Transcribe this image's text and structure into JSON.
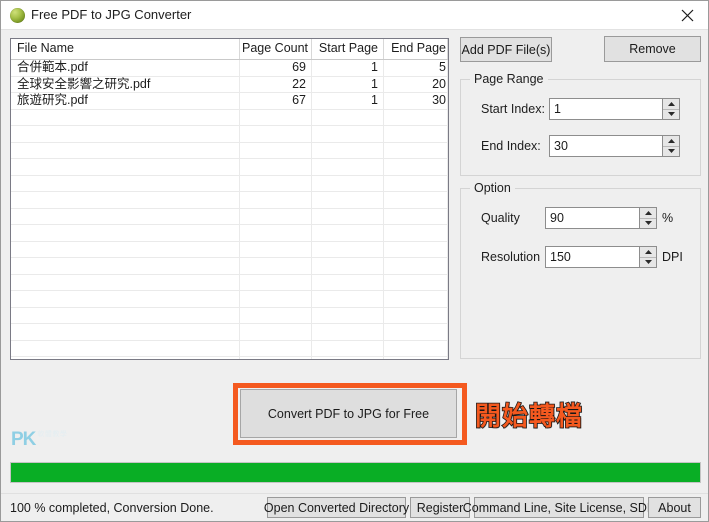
{
  "window": {
    "title": "Free PDF to JPG Converter",
    "icon": "green-sphere-icon",
    "close_label": "×",
    "accent_highlight_color": "#f4591f",
    "progress_color": "#09ae25",
    "background_color": "#efefef"
  },
  "file_list": {
    "columns": [
      {
        "label": "File Name",
        "align": "left"
      },
      {
        "label": "Page Count",
        "align": "right"
      },
      {
        "label": "Start Page",
        "align": "right"
      },
      {
        "label": "End Page",
        "align": "right"
      }
    ],
    "rows": [
      {
        "file_name": "合併範本.pdf",
        "page_count": "69",
        "start_page": "1",
        "end_page": "5"
      },
      {
        "file_name": "全球安全影響之研究.pdf",
        "page_count": "22",
        "start_page": "1",
        "end_page": "20"
      },
      {
        "file_name": "旅遊研究.pdf",
        "page_count": "67",
        "start_page": "1",
        "end_page": "30"
      }
    ],
    "empty_row_count": 17
  },
  "toolbar": {
    "add_label": "Add PDF File(s)",
    "remove_label": "Remove"
  },
  "page_range": {
    "group_label": "Page Range",
    "start_index_label": "Start Index:",
    "start_index_value": "1",
    "end_index_label": "End Index:",
    "end_index_value": "30"
  },
  "option": {
    "group_label": "Option",
    "quality_label": "Quality",
    "quality_value": "90",
    "quality_unit": "%",
    "resolution_label": "Resolution",
    "resolution_value": "150",
    "resolution_unit": "DPI"
  },
  "convert": {
    "button_label": "Convert PDF to JPG for Free",
    "annotation_text": "開始轉檔"
  },
  "watermark": {
    "text": "PK",
    "subtext": "軟體教學"
  },
  "progress": {
    "percent": 100,
    "percent_width": "100%"
  },
  "status": {
    "text": "100 % completed, Conversion Done."
  },
  "bottom_buttons": {
    "open_dir": "Open Converted Directory",
    "register": "Register",
    "cmdline": "Command Line, Site License, SDK",
    "about": "About"
  }
}
